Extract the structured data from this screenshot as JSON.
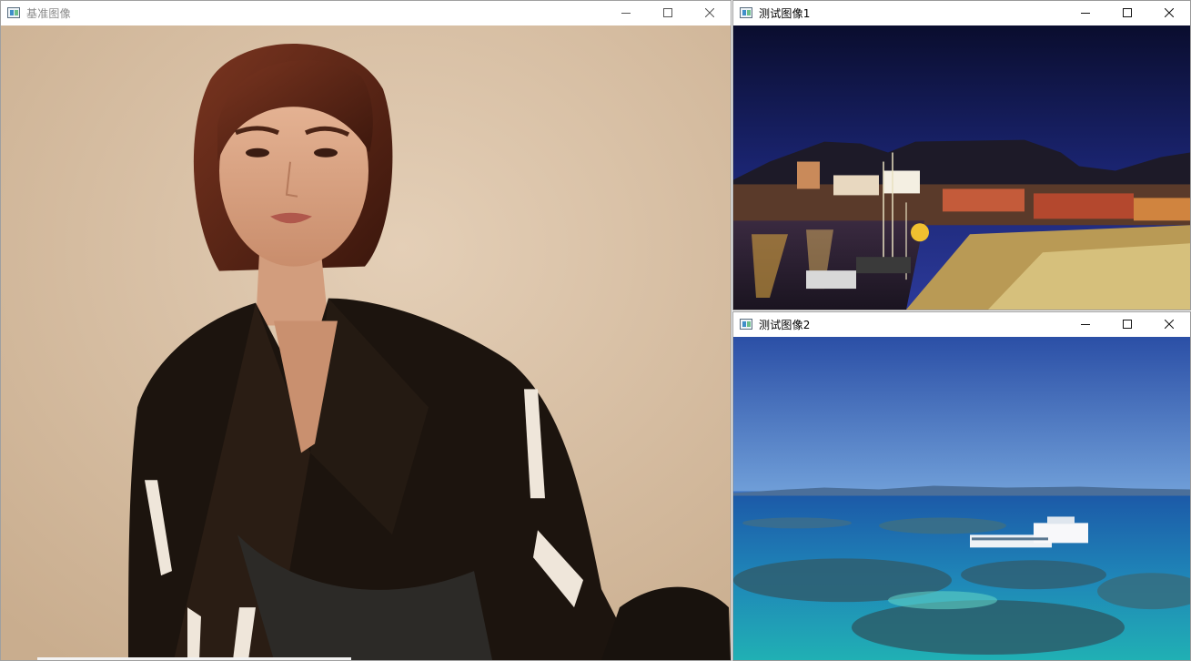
{
  "windows": {
    "reference": {
      "title": "基准图像",
      "controls": {
        "minimize": "minimize",
        "maximize": "maximize",
        "close": "close"
      },
      "image": "portrait of a woman with short auburn hair in a black blazer against a beige background"
    },
    "test1": {
      "title": "测试图像1",
      "controls": {
        "minimize": "minimize",
        "maximize": "maximize",
        "close": "close"
      },
      "image": "harbour waterfront at night with lit buildings, boats and a flat-topped mountain"
    },
    "test2": {
      "title": "测试图像2",
      "controls": {
        "minimize": "minimize",
        "maximize": "maximize",
        "close": "close"
      },
      "image": "aerial view of a tourist pontoon and boat over a turquoise coral reef under blue sky"
    }
  },
  "icons": [
    "app-icon",
    "minimize-icon",
    "maximize-icon",
    "close-icon"
  ]
}
